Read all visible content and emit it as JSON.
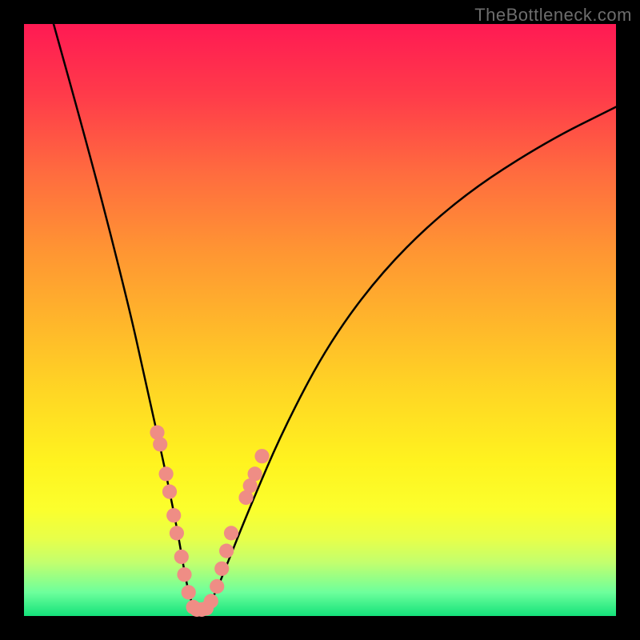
{
  "watermark": "TheBottleneck.com",
  "chart_data": {
    "type": "line",
    "title": "",
    "xlabel": "",
    "ylabel": "",
    "xlim": [
      0,
      100
    ],
    "ylim": [
      0,
      100
    ],
    "grid": false,
    "legend": false,
    "series": [
      {
        "name": "bottleneck-curve",
        "color": "#000000",
        "x": [
          5,
          10,
          14,
          18,
          20,
          22,
          24,
          26,
          27,
          28,
          29,
          30,
          32,
          34,
          38,
          44,
          52,
          62,
          74,
          88,
          100
        ],
        "y": [
          100,
          82,
          67,
          51,
          42,
          33,
          24,
          14,
          8,
          3,
          1,
          1,
          3,
          8,
          18,
          32,
          47,
          60,
          71,
          80,
          86
        ]
      }
    ],
    "markers": [
      {
        "group": "left-dots",
        "x": 22.5,
        "y": 31,
        "r": 1.3
      },
      {
        "group": "left-dots",
        "x": 23.0,
        "y": 29,
        "r": 1.3
      },
      {
        "group": "left-dots",
        "x": 24.0,
        "y": 24,
        "r": 1.3
      },
      {
        "group": "left-dots",
        "x": 24.6,
        "y": 21,
        "r": 1.3
      },
      {
        "group": "left-dots",
        "x": 25.3,
        "y": 17,
        "r": 1.3
      },
      {
        "group": "left-dots",
        "x": 25.8,
        "y": 14,
        "r": 1.3
      },
      {
        "group": "left-dots",
        "x": 26.6,
        "y": 10,
        "r": 1.3
      },
      {
        "group": "left-dots",
        "x": 27.1,
        "y": 7,
        "r": 1.3
      },
      {
        "group": "left-dots",
        "x": 27.8,
        "y": 4,
        "r": 1.3
      },
      {
        "group": "bottom-dots",
        "x": 28.6,
        "y": 1.5,
        "r": 1.3
      },
      {
        "group": "bottom-dots",
        "x": 29.2,
        "y": 1.1,
        "r": 1.3
      },
      {
        "group": "bottom-dots",
        "x": 30.0,
        "y": 1.1,
        "r": 1.3
      },
      {
        "group": "bottom-dots",
        "x": 30.8,
        "y": 1.3,
        "r": 1.3
      },
      {
        "group": "right-dots",
        "x": 31.6,
        "y": 2.5,
        "r": 1.3
      },
      {
        "group": "right-dots",
        "x": 32.6,
        "y": 5,
        "r": 1.3
      },
      {
        "group": "right-dots",
        "x": 33.4,
        "y": 8,
        "r": 1.3
      },
      {
        "group": "right-dots",
        "x": 34.2,
        "y": 11,
        "r": 1.3
      },
      {
        "group": "right-dots",
        "x": 35.0,
        "y": 14,
        "r": 1.3
      },
      {
        "group": "right-dots",
        "x": 37.5,
        "y": 20,
        "r": 1.3
      },
      {
        "group": "right-dots",
        "x": 38.2,
        "y": 22,
        "r": 1.3
      },
      {
        "group": "right-dots",
        "x": 39.0,
        "y": 24,
        "r": 1.3
      },
      {
        "group": "right-dots",
        "x": 40.2,
        "y": 27,
        "r": 1.3
      }
    ],
    "marker_color": "#ef8d85"
  }
}
